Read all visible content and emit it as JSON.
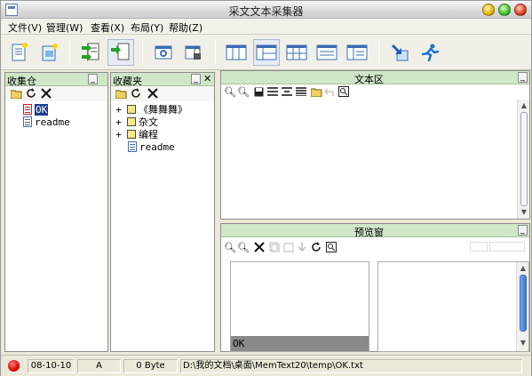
{
  "window": {
    "title": "采文文本采集器"
  },
  "menu": [
    "文件(V)",
    "管理(W)",
    "查看(X)",
    "布局(Y)",
    "帮助(Z)"
  ],
  "toolbar": {
    "buttons": [
      "new-doc-icon",
      "open-doc-icon",
      "collect-icon",
      "collect-page-icon",
      "settings-window-icon",
      "lock-window-icon",
      "layout-1-icon",
      "layout-2-icon",
      "layout-3-icon",
      "layout-4-icon",
      "layout-5-icon",
      "arrow-in-icon",
      "run-icon"
    ]
  },
  "panels": {
    "collect": {
      "title": "收集仓",
      "items": [
        {
          "label": "OK",
          "selected": true
        },
        {
          "label": "readme",
          "selected": false
        }
      ]
    },
    "favorites": {
      "title": "收藏夹",
      "items": [
        {
          "label": "《舞舞舞》",
          "type": "folder",
          "expander": "+"
        },
        {
          "label": "杂文",
          "type": "folder",
          "expander": "+"
        },
        {
          "label": "编程",
          "type": "folder",
          "expander": "+"
        },
        {
          "label": "readme",
          "type": "doc",
          "expander": ""
        }
      ]
    },
    "text": {
      "title": "文本区"
    },
    "preview": {
      "title": "预览窗",
      "list_item": "OK"
    }
  },
  "status": {
    "date": "08-10-10",
    "mode": "A",
    "size": "0 Byte",
    "path": "D:\\我的文档\\桌面\\MemText20\\temp\\OK.txt"
  },
  "colors": {
    "panel_header": "#cfe6c8",
    "selection": "#1d3f8f",
    "preview_item": "#8a8a8a",
    "record": "#dd0000"
  }
}
